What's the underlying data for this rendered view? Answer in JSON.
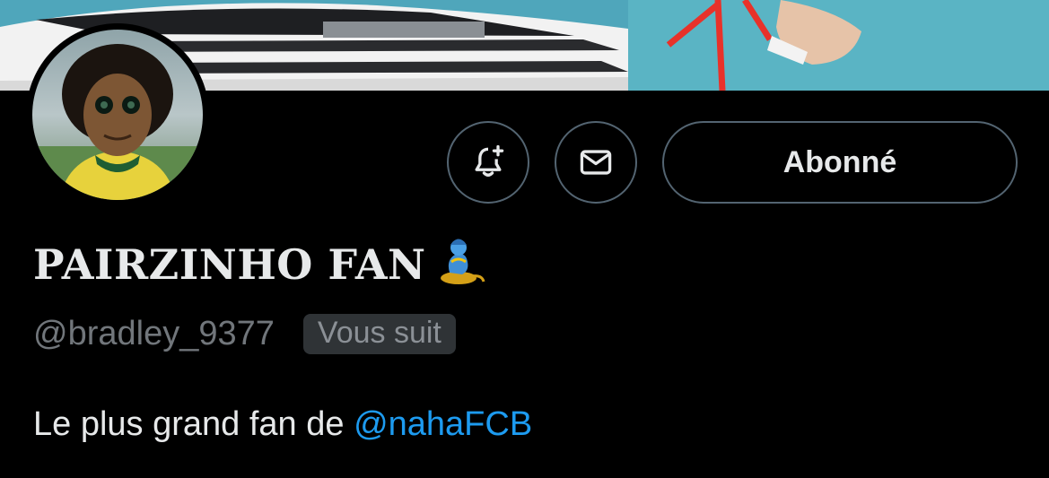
{
  "header": {
    "banner_icon": "cruise-ship-banner-image",
    "avatar_icon": "cartoon-avatar-image"
  },
  "actions": {
    "notify_icon": "bell-plus-icon",
    "message_icon": "envelope-icon",
    "follow_label": "Abonné"
  },
  "profile": {
    "display_name": "PAIRZINHO FAN",
    "name_emoji": "genie-emoji",
    "handle": "@bradley_9377",
    "follows_you_badge": "Vous suit"
  },
  "bio": {
    "text": "Le plus grand fan de ",
    "mention": "@nahaFCB"
  },
  "colors": {
    "background": "#000000",
    "text_primary": "#e7e9ea",
    "text_secondary": "#71767b",
    "link": "#1d9bf0",
    "border": "#536471",
    "badge_bg": "#2f3336"
  }
}
